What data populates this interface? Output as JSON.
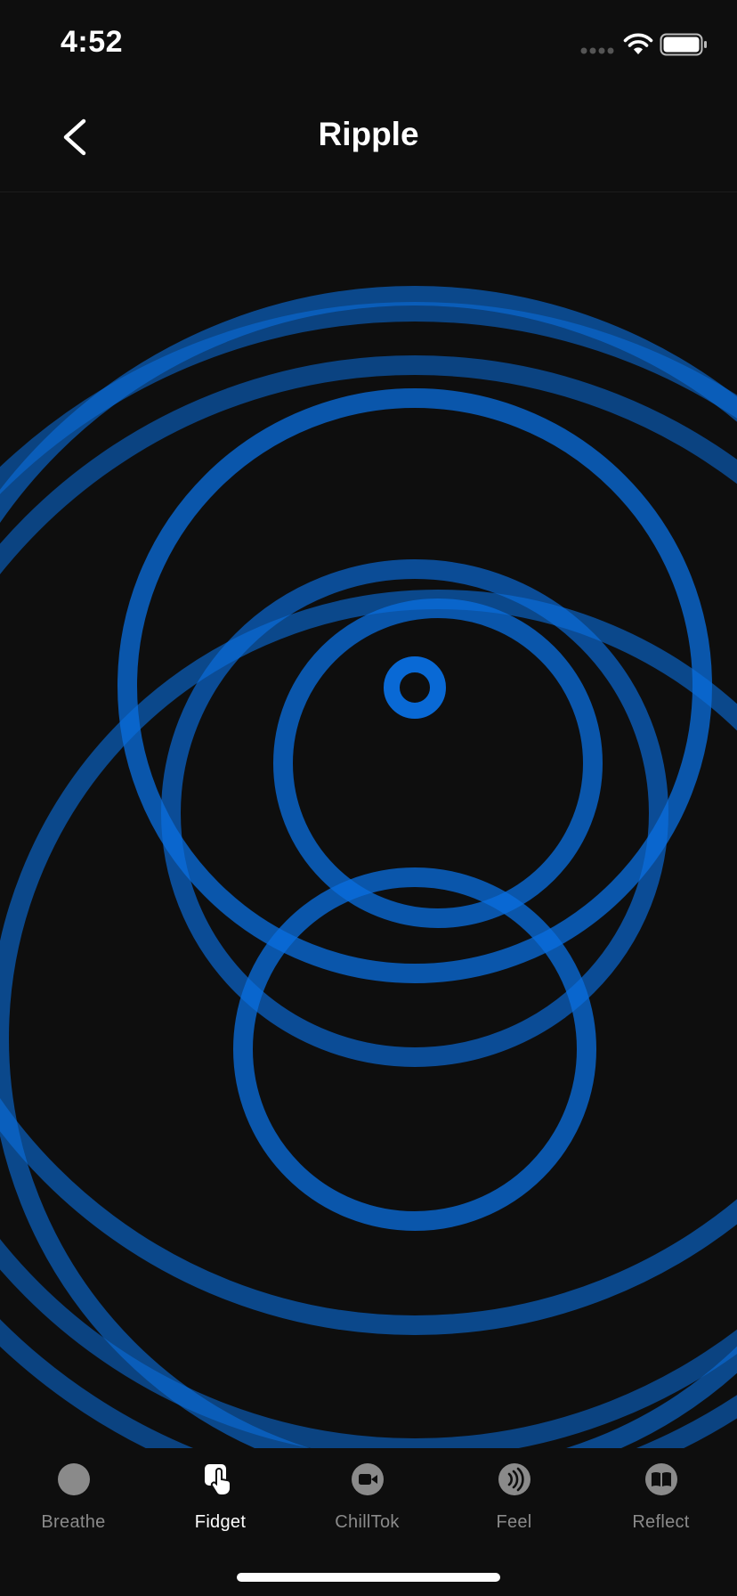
{
  "status_bar": {
    "time": "4:52"
  },
  "header": {
    "title": "Ripple",
    "back_icon": "chevron-left-icon"
  },
  "colors": {
    "background": "#0e0e0e",
    "ripple": "#0a6fe0",
    "tab_inactive": "#8a8a8a",
    "tab_active": "#ffffff"
  },
  "tabs": [
    {
      "label": "Breathe",
      "icon": "circle-icon",
      "active": false
    },
    {
      "label": "Fidget",
      "icon": "hand-tap-icon",
      "active": true
    },
    {
      "label": "ChillTok",
      "icon": "video-camera-icon",
      "active": false
    },
    {
      "label": "Feel",
      "icon": "vibration-icon",
      "active": false
    },
    {
      "label": "Reflect",
      "icon": "book-icon",
      "active": false
    }
  ]
}
